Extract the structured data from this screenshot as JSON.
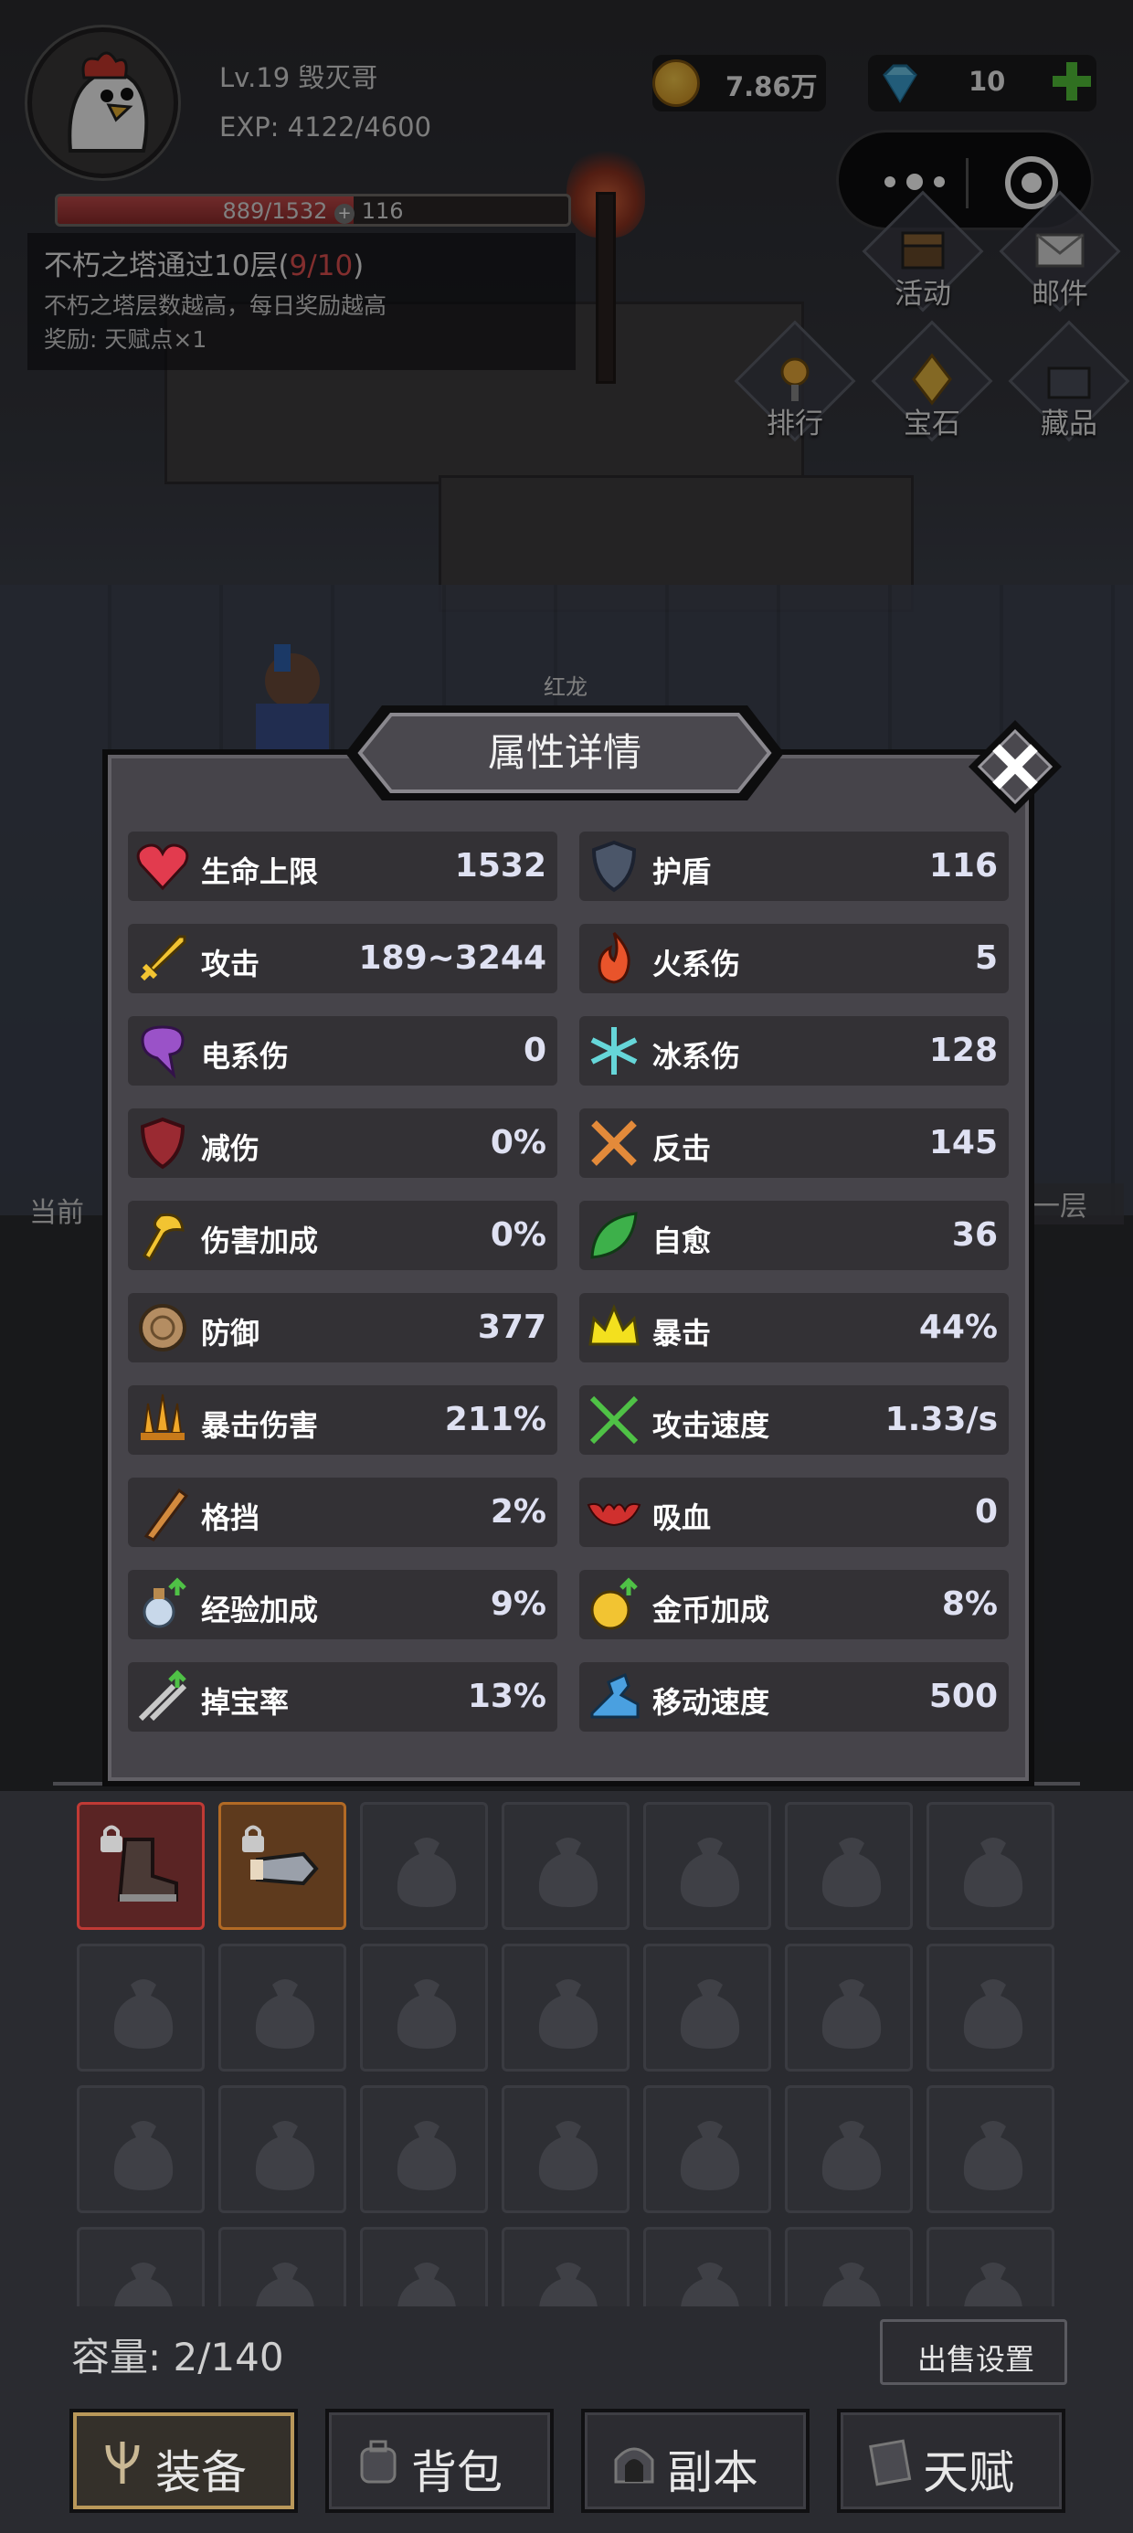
{
  "player": {
    "level_name": "Lv.19 毁灭哥",
    "exp_text": "EXP: 4122/4600",
    "hp_text": "889/1532",
    "shield_text": "116",
    "hp_fraction": 0.58
  },
  "quest": {
    "title": "不朽之塔通过10层(",
    "progress": "9/10",
    "title_close": ")",
    "desc": "不朽之塔层数越高，每日奖励越高",
    "reward": "奖励: 天赋点×1"
  },
  "currency": {
    "gold": "7.86万",
    "gems": "10"
  },
  "side_buttons": {
    "activity": "活动",
    "mail": "邮件",
    "rank": "排行",
    "gem": "宝石",
    "collection": "藏品"
  },
  "scene": {
    "boss_name": "红龙",
    "current_floor_label": "当前",
    "floor_right": "一层"
  },
  "modal": {
    "title": "属性详情",
    "stats": [
      {
        "name": "生命上限",
        "value": "1532",
        "icon": "heart-icon"
      },
      {
        "name": "护盾",
        "value": "116",
        "icon": "shield-icon"
      },
      {
        "name": "攻击",
        "value": "189~3244",
        "icon": "sword-icon"
      },
      {
        "name": "火系伤",
        "value": "5",
        "icon": "fire-icon"
      },
      {
        "name": "电系伤",
        "value": "0",
        "icon": "lightning-icon"
      },
      {
        "name": "冰系伤",
        "value": "128",
        "icon": "snowflake-icon"
      },
      {
        "name": "减伤",
        "value": "0%",
        "icon": "damage-reduction-icon"
      },
      {
        "name": "反击",
        "value": "145",
        "icon": "crossed-swords-icon"
      },
      {
        "name": "伤害加成",
        "value": "0%",
        "icon": "axe-icon"
      },
      {
        "name": "自愈",
        "value": "36",
        "icon": "leaf-icon"
      },
      {
        "name": "防御",
        "value": "377",
        "icon": "round-shield-icon"
      },
      {
        "name": "暴击",
        "value": "44%",
        "icon": "crown-icon"
      },
      {
        "name": "暴击伤害",
        "value": "211%",
        "icon": "blades-icon"
      },
      {
        "name": "攻击速度",
        "value": "1.33/s",
        "icon": "arrows-icon"
      },
      {
        "name": "格挡",
        "value": "2%",
        "icon": "block-icon"
      },
      {
        "name": "吸血",
        "value": "0",
        "icon": "bat-icon"
      },
      {
        "name": "经验加成",
        "value": "9%",
        "icon": "potion-icon"
      },
      {
        "name": "金币加成",
        "value": "8%",
        "icon": "coin-bonus-icon"
      },
      {
        "name": "掉宝率",
        "value": "13%",
        "icon": "loot-icon"
      },
      {
        "name": "移动速度",
        "value": "500",
        "icon": "boot-icon"
      }
    ]
  },
  "inventory": {
    "capacity_text": "容量: 2/140",
    "sell_settings": "出售设置",
    "equipped_slots": [
      "boots-icon",
      "gauntlet-icon"
    ]
  },
  "bottom_nav": {
    "equipment": "装备",
    "backpack": "背包",
    "dungeon": "副本",
    "talent": "天赋"
  },
  "colors": {
    "modal_bg": "#46444a",
    "cell_bg": "#333135",
    "value_text": "#dfe1f2",
    "quest_progress": "#e05050",
    "plus_green": "#53c13a"
  }
}
